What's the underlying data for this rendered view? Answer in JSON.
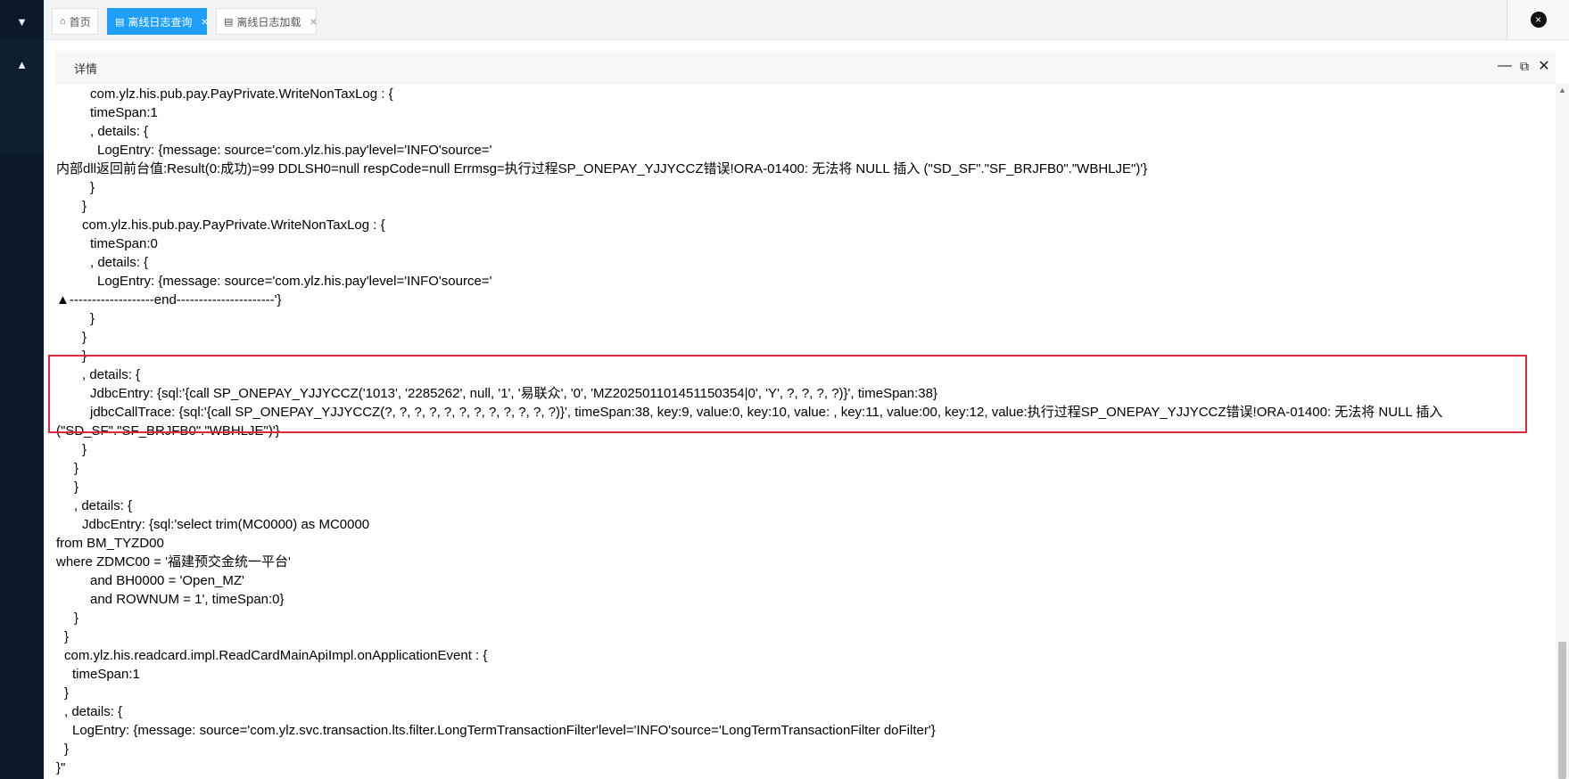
{
  "tabs": [
    {
      "icon": "home-icon",
      "label": "首页",
      "active": false
    },
    {
      "icon": "document-icon",
      "label": "离线日志查询",
      "active": true,
      "closable": true
    },
    {
      "icon": "document-icon",
      "label": "离线日志加载",
      "active": false,
      "closable": true
    }
  ],
  "close_glyph": "×",
  "panel": {
    "title": "详情",
    "minimize_glyph": "—",
    "maximize_glyph": "⧉",
    "close_glyph": "✕"
  },
  "log_lines": [
    {
      "indent": 38,
      "text": "com.ylz.his.pub.pay.PayPrivate.WriteNonTaxLog : {"
    },
    {
      "indent": 38,
      "text": "timeSpan:1"
    },
    {
      "indent": 38,
      "text": ", details: {"
    },
    {
      "indent": 46,
      "text": "LogEntry: {message: source='com.ylz.his.pay'level='INFO'source='"
    },
    {
      "indent": 0,
      "text": "内部dll返回前台值:Result(0:成功)=99 DDLSH0=null respCode=null Errmsg=执行过程SP_ONEPAY_YJJYCCZ错误!ORA-01400: 无法将 NULL 插入 (\"SD_SF\".\"SF_BRJFB0\".\"WBHLJE\")'}"
    },
    {
      "indent": 38,
      "text": "}"
    },
    {
      "indent": 29,
      "text": "}"
    },
    {
      "indent": 29,
      "text": "com.ylz.his.pub.pay.PayPrivate.WriteNonTaxLog : {"
    },
    {
      "indent": 38,
      "text": "timeSpan:0"
    },
    {
      "indent": 38,
      "text": ", details: {"
    },
    {
      "indent": 46,
      "text": "LogEntry: {message: source='com.ylz.his.pay'level='INFO'source='"
    },
    {
      "indent": 0,
      "text": "▲-------------------end----------------------'}"
    },
    {
      "indent": 38,
      "text": "}"
    },
    {
      "indent": 29,
      "text": "}"
    },
    {
      "indent": 29,
      "text": "}"
    },
    {
      "indent": 29,
      "text": ", details: {"
    },
    {
      "indent": 38,
      "text": "JdbcEntry: {sql:'{call SP_ONEPAY_YJJYCCZ('1013', '2285262', null, '1', '易联众', '0', 'MZ202501101451150354|0', 'Y', ?, ?, ?, ?)}', timeSpan:38}"
    },
    {
      "indent": 38,
      "text": "jdbcCallTrace: {sql:'{call SP_ONEPAY_YJJYCCZ(?, ?, ?, ?, ?, ?, ?, ?, ?, ?, ?, ?)}', timeSpan:38, key:9, value:0, key:10, value: , key:11, value:00, key:12, value:执行过程SP_ONEPAY_YJJYCCZ错误!ORA-01400: 无法将 NULL 插入"
    },
    {
      "indent": 0,
      "text": "(\"SD_SF\".\"SF_BRJFB0\".\"WBHLJE\")'}"
    },
    {
      "indent": 29,
      "text": "}"
    },
    {
      "indent": 20,
      "text": "}"
    },
    {
      "indent": 20,
      "text": "}"
    },
    {
      "indent": 20,
      "text": ", details: {"
    },
    {
      "indent": 29,
      "text": "JdbcEntry: {sql:'select trim(MC0000) as MC0000"
    },
    {
      "indent": 0,
      "text": "from BM_TYZD00"
    },
    {
      "indent": 0,
      "text": "where ZDMC00 = '福建预交金统一平台'"
    },
    {
      "indent": 38,
      "text": "and BH0000 = 'Open_MZ'"
    },
    {
      "indent": 38,
      "text": "and ROWNUM = 1', timeSpan:0}"
    },
    {
      "indent": 20,
      "text": "}"
    },
    {
      "indent": 9,
      "text": "}"
    },
    {
      "indent": 9,
      "text": "com.ylz.his.readcard.impl.ReadCardMainApiImpl.onApplicationEvent : {"
    },
    {
      "indent": 18,
      "text": "timeSpan:1"
    },
    {
      "indent": 9,
      "text": "}"
    },
    {
      "indent": 9,
      "text": ", details: {"
    },
    {
      "indent": 18,
      "text": "LogEntry: {message: source='com.ylz.svc.transaction.lts.filter.LongTermTransactionFilter'level='INFO'source='LongTermTransactionFilter doFilter'}"
    },
    {
      "indent": 9,
      "text": "}"
    },
    {
      "indent": 0,
      "text": "}\""
    },
    {
      "indent": 0,
      "text": "}"
    }
  ]
}
